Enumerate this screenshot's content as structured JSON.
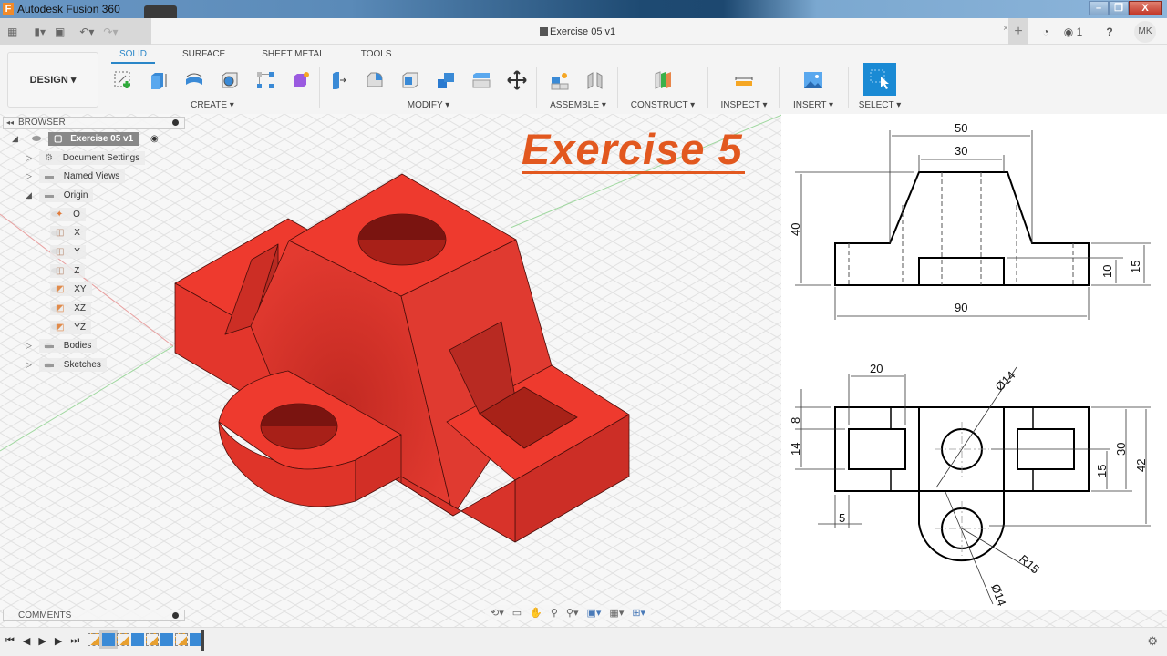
{
  "window": {
    "app_title": "Autodesk Fusion 360",
    "app_icon_letter": "F",
    "minimize": "–",
    "restore": "❐",
    "close": "X"
  },
  "quick_access": {
    "grid_icon": "▦",
    "file_icon": "▮▾",
    "save_icon": "▣",
    "undo_icon": "↶▾",
    "redo_icon": "↷▾",
    "document_title": "Exercise 05 v1",
    "tab_close": "×",
    "new_tab": "+",
    "jobs_count": "1",
    "help": "?",
    "user_initials": "MK"
  },
  "ribbon": {
    "workspace": "DESIGN",
    "tabs": [
      "SOLID",
      "SURFACE",
      "SHEET METAL",
      "TOOLS"
    ],
    "active_tab": "SOLID",
    "groups": [
      {
        "label": "CREATE",
        "tools": [
          "create-sketch",
          "extrude",
          "revolve",
          "hole",
          "pattern",
          "create-form"
        ]
      },
      {
        "label": "MODIFY",
        "tools": [
          "press-pull",
          "fillet",
          "shell",
          "combine",
          "replace-face",
          "move"
        ]
      },
      {
        "label": "ASSEMBLE",
        "tools": [
          "new-component",
          "joint"
        ]
      },
      {
        "label": "CONSTRUCT",
        "tools": [
          "offset-plane"
        ]
      },
      {
        "label": "INSPECT",
        "tools": [
          "measure"
        ]
      },
      {
        "label": "INSERT",
        "tools": [
          "insert-image"
        ]
      },
      {
        "label": "SELECT",
        "tools": [
          "window-select"
        ]
      }
    ],
    "colors": {
      "accent": "#2a86c8",
      "select_bg": "#1a8ad4"
    }
  },
  "browser": {
    "title": "BROWSER",
    "items": [
      {
        "label": "Exercise 05 v1",
        "level": 0,
        "expanded": true,
        "root": true
      },
      {
        "label": "Document Settings",
        "level": 1,
        "expanded": false,
        "icon": "gear"
      },
      {
        "label": "Named Views",
        "level": 1,
        "expanded": false,
        "icon": "folder"
      },
      {
        "label": "Origin",
        "level": 1,
        "expanded": true,
        "icon": "folder"
      },
      {
        "label": "O",
        "level": 2,
        "icon": "point"
      },
      {
        "label": "X",
        "level": 2,
        "icon": "axis"
      },
      {
        "label": "Y",
        "level": 2,
        "icon": "axis"
      },
      {
        "label": "Z",
        "level": 2,
        "icon": "axis"
      },
      {
        "label": "XY",
        "level": 2,
        "icon": "plane"
      },
      {
        "label": "XZ",
        "level": 2,
        "icon": "plane"
      },
      {
        "label": "YZ",
        "level": 2,
        "icon": "plane"
      },
      {
        "label": "Bodies",
        "level": 1,
        "expanded": false,
        "icon": "folder"
      },
      {
        "label": "Sketches",
        "level": 1,
        "expanded": false,
        "icon": "folder"
      }
    ]
  },
  "comments": {
    "title": "COMMENTS"
  },
  "canvas": {
    "overlay_title": "Exercise 5",
    "overlay_color": "#e2581f",
    "model_color": "#e8352b"
  },
  "drawing": {
    "front_view_dims": [
      "50",
      "30",
      "40",
      "15",
      "10",
      "90"
    ],
    "top_view_dims": [
      "20",
      "Ø14",
      "8",
      "14",
      "30",
      "42",
      "15",
      "5",
      "R15",
      "Ø14"
    ]
  },
  "nav_bar": {
    "tools": [
      "orbit",
      "look-at",
      "pan",
      "zoom",
      "fit",
      "display-settings",
      "grid-settings",
      "viewports"
    ]
  },
  "timeline": {
    "controls": [
      "first",
      "previous",
      "play",
      "next",
      "last"
    ],
    "features": [
      "sketch",
      "extrude",
      "sketch",
      "extrude",
      "sketch",
      "extrude",
      "sketch",
      "extrude"
    ]
  }
}
